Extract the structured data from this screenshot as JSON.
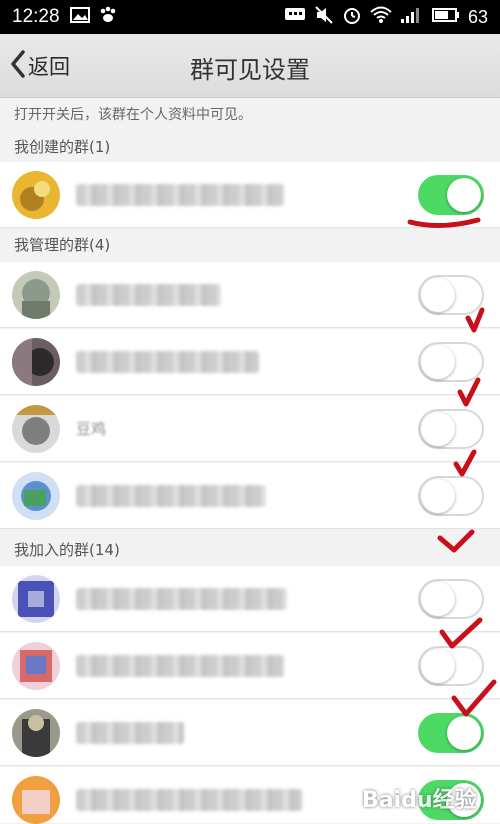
{
  "status_bar": {
    "time": "12:28",
    "battery": "63",
    "icons_left": [
      "image-icon",
      "paw-icon"
    ],
    "icons_right": [
      "message-icon",
      "mute-icon",
      "alarm-icon",
      "wifi-icon",
      "signal-icon",
      "battery-icon"
    ]
  },
  "header": {
    "back_label": "返回",
    "title": "群可见设置"
  },
  "hint": "打开开关后，该群在个人资料中可见。",
  "sections": {
    "created": "我创建的群(1)",
    "managed": "我管理的群(4)",
    "joined": "我加入的群(14)"
  },
  "rows": [
    {
      "section": "created",
      "on": true,
      "avatar": "#e8b630"
    },
    {
      "section": "managed",
      "on": false,
      "avatar": "#8b9a8a"
    },
    {
      "section": "managed",
      "on": false,
      "avatar": "#4a4040"
    },
    {
      "section": "managed",
      "on": false,
      "avatar": "#7f7f7f",
      "name": "豆鸡"
    },
    {
      "section": "managed",
      "on": false,
      "avatar": "#5b8fd0"
    },
    {
      "section": "joined",
      "on": false,
      "avatar": "#4a52b8"
    },
    {
      "section": "joined",
      "on": false,
      "avatar": "#d46a6a"
    },
    {
      "section": "joined",
      "on": true,
      "avatar": "#3a3a3a"
    },
    {
      "section": "joined",
      "on": true,
      "avatar": "#f0a040"
    }
  ],
  "colors": {
    "switch_on": "#4cd964",
    "annotation": "#c8101c"
  },
  "watermark": "Baidu经验"
}
